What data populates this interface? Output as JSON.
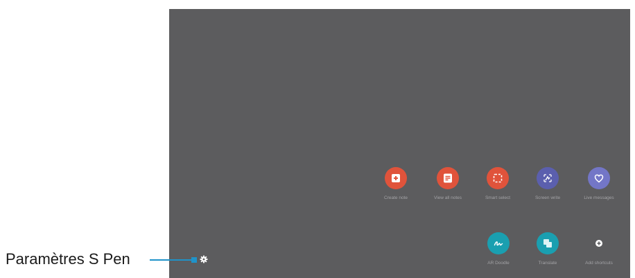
{
  "callout": {
    "label": "Paramètres S Pen"
  },
  "air_command": {
    "row1": [
      {
        "label": "Create note",
        "icon": "create-note-icon",
        "color": "#e0533b"
      },
      {
        "label": "View all notes",
        "icon": "view-notes-icon",
        "color": "#e0533b"
      },
      {
        "label": "Smart select",
        "icon": "smart-select-icon",
        "color": "#e0533b"
      },
      {
        "label": "Screen write",
        "icon": "screen-write-icon",
        "color": "#5b5fae"
      },
      {
        "label": "Live messages",
        "icon": "live-messages-icon",
        "color": "#7376c7"
      }
    ],
    "row2": [
      {
        "label": "AR Doodle",
        "icon": "ar-doodle-icon",
        "color": "#1a9fb0"
      },
      {
        "label": "Translate",
        "icon": "translate-icon",
        "color": "#1a9fb0"
      },
      {
        "label": "Add shortcuts",
        "icon": "add-shortcuts-icon",
        "color": "#5c5c5e"
      }
    ]
  },
  "colors": {
    "screen_bg": "#5c5c5e",
    "callout_line": "#1f93c9"
  }
}
